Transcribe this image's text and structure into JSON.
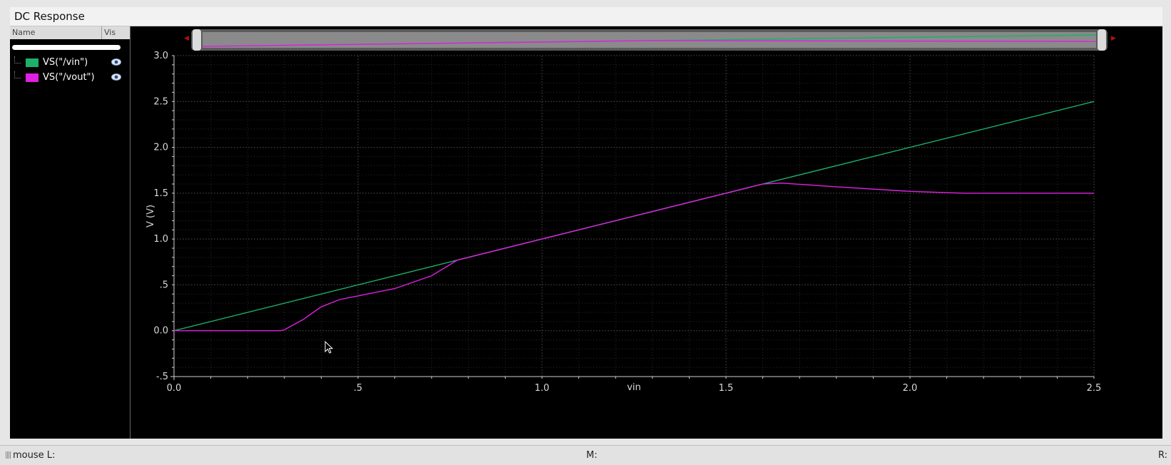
{
  "window": {
    "title": "DC Response"
  },
  "legend": {
    "col_name": "Name",
    "col_vis": "Vis",
    "items": [
      {
        "label": "VS(\"/vin\")",
        "color": "#1db06a",
        "icon": "eye-icon"
      },
      {
        "label": "VS(\"/vout\")",
        "color": "#e020e0",
        "icon": "eye-icon"
      }
    ]
  },
  "status": {
    "mouse_l": "mouse L:",
    "mouse_m": "M:",
    "mouse_r": "R:"
  },
  "chart_data": {
    "type": "line",
    "xlabel": "vin",
    "ylabel": "V (V)",
    "xlim": [
      0,
      2.5
    ],
    "ylim": [
      -0.5,
      3.0
    ],
    "x_ticks": [
      "0.0",
      ".5",
      "1.0",
      "1.5",
      "2.0",
      "2.5"
    ],
    "y_ticks": [
      "-.5",
      "0.0",
      ".5",
      "1.0",
      "1.5",
      "2.0",
      "2.5",
      "3.0"
    ],
    "grid": true,
    "series": [
      {
        "name": "VS(\"/vin\")",
        "color": "#1db06a",
        "x": [
          0,
          2.5
        ],
        "y": [
          0,
          2.5
        ]
      },
      {
        "name": "VS(\"/vout\")",
        "color": "#e020e0",
        "x": [
          0,
          0.29,
          0.3,
          0.35,
          0.4,
          0.45,
          0.5,
          0.6,
          0.7,
          0.77,
          1.0,
          1.25,
          1.5,
          1.6,
          1.65,
          1.8,
          2.0,
          2.15,
          2.5
        ],
        "y": [
          0,
          0,
          0.01,
          0.12,
          0.26,
          0.34,
          0.38,
          0.46,
          0.6,
          0.77,
          1.0,
          1.25,
          1.5,
          1.6,
          1.61,
          1.57,
          1.52,
          1.5,
          1.5
        ]
      }
    ]
  }
}
